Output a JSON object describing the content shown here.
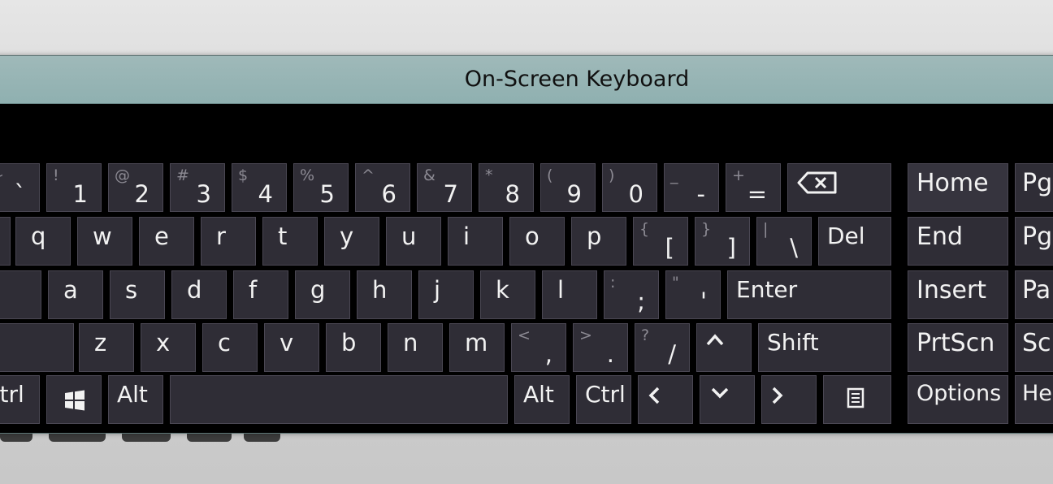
{
  "window": {
    "title": "On-Screen Keyboard"
  },
  "rows": {
    "numbers": [
      {
        "id": "backtick",
        "shift": "~",
        "main": "`"
      },
      {
        "id": "1",
        "shift": "!",
        "main": "1"
      },
      {
        "id": "2",
        "shift": "@",
        "main": "2"
      },
      {
        "id": "3",
        "shift": "#",
        "main": "3"
      },
      {
        "id": "4",
        "shift": "$",
        "main": "4"
      },
      {
        "id": "5",
        "shift": "%",
        "main": "5"
      },
      {
        "id": "6",
        "shift": "^",
        "main": "6"
      },
      {
        "id": "7",
        "shift": "&",
        "main": "7"
      },
      {
        "id": "8",
        "shift": "*",
        "main": "8"
      },
      {
        "id": "9",
        "shift": "(",
        "main": "9"
      },
      {
        "id": "0",
        "shift": ")",
        "main": "0"
      },
      {
        "id": "minus",
        "shift": "_",
        "main": "-"
      },
      {
        "id": "equals",
        "shift": "+",
        "main": "="
      }
    ],
    "qwerty": [
      "q",
      "w",
      "e",
      "r",
      "t",
      "y",
      "u",
      "i",
      "o",
      "p"
    ],
    "qwerty_symbols": [
      {
        "id": "bracket-left",
        "shift": "{",
        "main": "["
      },
      {
        "id": "bracket-right",
        "shift": "}",
        "main": "]"
      },
      {
        "id": "backslash",
        "shift": "|",
        "main": "\\"
      }
    ],
    "home": [
      "a",
      "s",
      "d",
      "f",
      "g",
      "h",
      "j",
      "k",
      "l"
    ],
    "home_symbols": [
      {
        "id": "semicolon",
        "shift": ":",
        "main": ";"
      },
      {
        "id": "quote",
        "shift": "\"",
        "main": "'"
      }
    ],
    "bottom": [
      "z",
      "x",
      "c",
      "v",
      "b",
      "n",
      "m"
    ],
    "bottom_symbols": [
      {
        "id": "comma",
        "shift": "<",
        "main": ","
      },
      {
        "id": "period",
        "shift": ">",
        "main": "."
      },
      {
        "id": "slash",
        "shift": "?",
        "main": "/"
      }
    ]
  },
  "keys": {
    "backspace_icon": "backspace-icon",
    "del": "Del",
    "enter": "Enter",
    "shift": "Shift",
    "ctrl_left": "Ctrl",
    "windows_icon": "windows-logo-icon",
    "alt_left": "Alt",
    "alt_right": "Alt",
    "ctrl_right": "Ctrl",
    "arrow_up_icon": "arrow-up-icon",
    "arrow_left_icon": "arrow-left-icon",
    "arrow_down_icon": "arrow-down-icon",
    "arrow_right_icon": "arrow-right-icon",
    "menu_icon": "context-menu-icon"
  },
  "nav": {
    "home": "Home",
    "end": "End",
    "insert": "Insert",
    "prtscn": "PrtScn",
    "options": "Options",
    "pgup": "Pg",
    "pgdn": "Pg",
    "pause": "Pa",
    "scrlk": "Scr",
    "help": "He"
  }
}
